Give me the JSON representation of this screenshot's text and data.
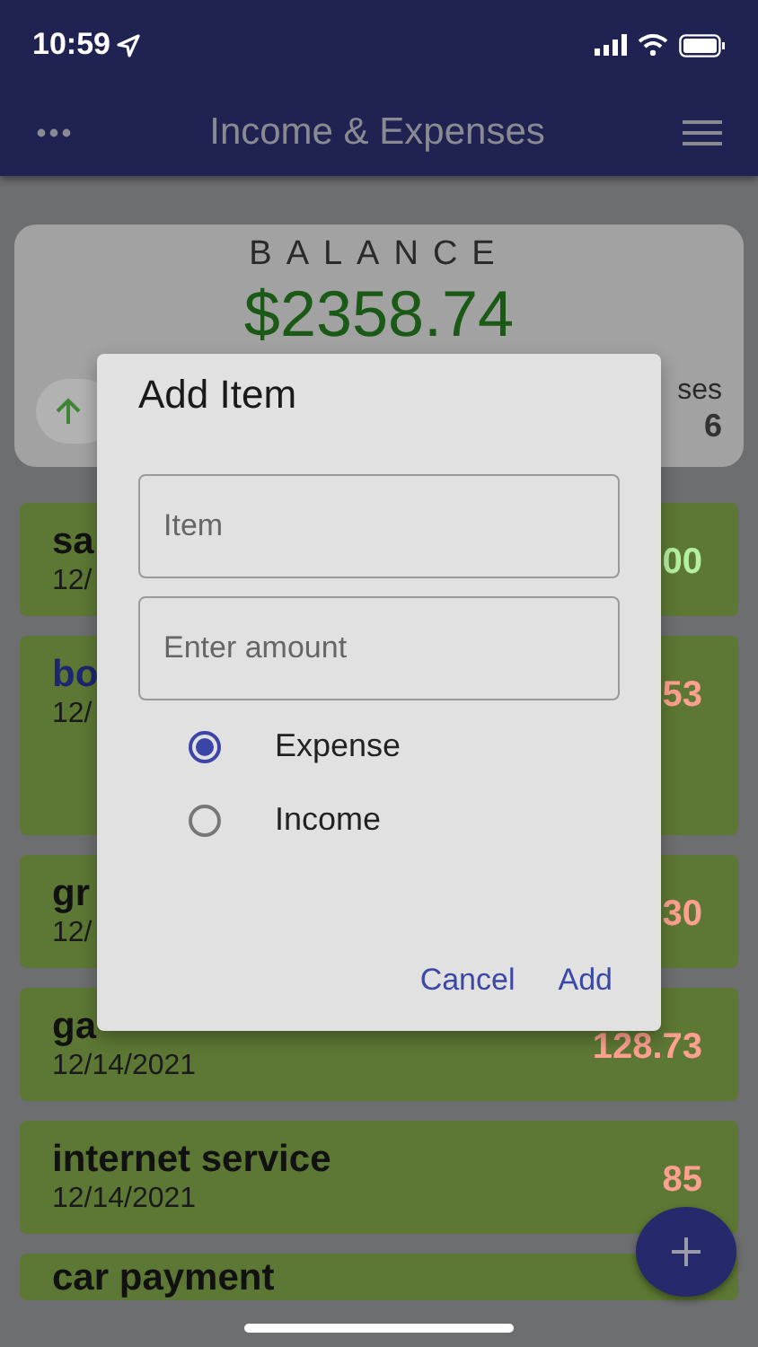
{
  "status_bar": {
    "time": "10:59"
  },
  "app_bar": {
    "title": "Income & Expenses"
  },
  "balance": {
    "label": "BALANCE",
    "amount": "$2358.74",
    "expenses_label": "ses",
    "expenses_value": "6"
  },
  "entries": [
    {
      "name": "sa",
      "date": "12/",
      "amount": "00",
      "kind": "income",
      "selected": false
    },
    {
      "name": "bo",
      "date": "12/",
      "amount": "53",
      "kind": "expense",
      "selected": true
    },
    {
      "name": "gr",
      "date": "12/",
      "amount": "30",
      "kind": "expense",
      "selected": false
    },
    {
      "name": "ga",
      "date": "12/14/2021",
      "amount": "128.73",
      "kind": "expense",
      "selected": false
    },
    {
      "name": "internet service",
      "date": "12/14/2021",
      "amount": "85",
      "kind": "expense",
      "selected": false
    },
    {
      "name": "car payment",
      "selected": false
    }
  ],
  "dialog": {
    "title": "Add Item",
    "fields": [
      {
        "placeholder": "Item"
      },
      {
        "placeholder": "Enter amount"
      }
    ],
    "options": [
      {
        "label": "Expense",
        "selected": true
      },
      {
        "label": "Income",
        "selected": false
      }
    ],
    "buttons": [
      "Cancel",
      "Add"
    ]
  }
}
